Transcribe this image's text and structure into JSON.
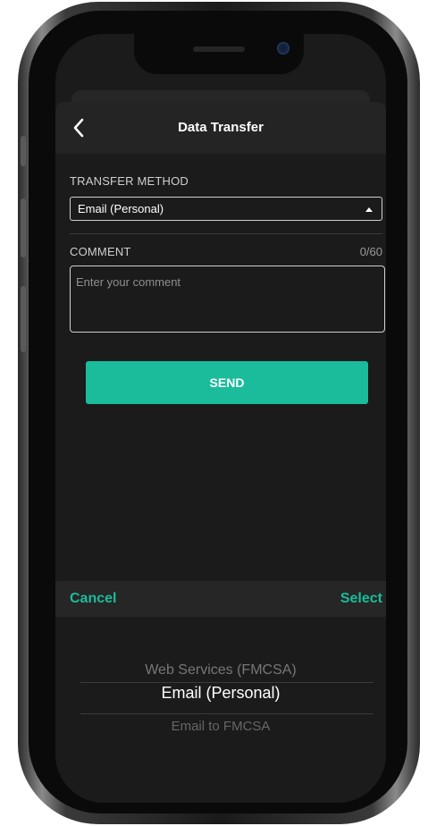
{
  "header": {
    "title": "Data Transfer"
  },
  "form": {
    "transfer_method_label": "TRANSFER METHOD",
    "transfer_method_value": "Email (Personal)",
    "comment_label": "COMMENT",
    "comment_counter": "0/60",
    "comment_placeholder": "Enter your comment",
    "send_label": "SEND"
  },
  "picker": {
    "cancel_label": "Cancel",
    "select_label": "Select",
    "options": [
      "Web Services (FMCSA)",
      "Email (Personal)",
      "Email to FMCSA"
    ],
    "selected": "Email (Personal)"
  },
  "colors": {
    "accent": "#1abc9c",
    "background": "#1b1b1b",
    "header": "#242424"
  }
}
